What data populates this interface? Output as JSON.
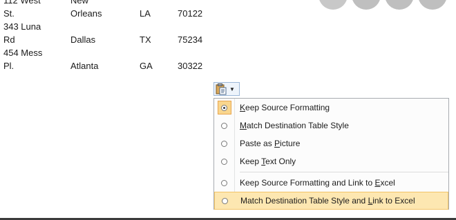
{
  "addresses": [
    {
      "street": "112 West",
      "city": "New",
      "state": "",
      "zip": ""
    },
    {
      "street": "St.",
      "city": "Orleans",
      "state": "LA",
      "zip": "70122"
    },
    {
      "street": "343 Luna",
      "city": "",
      "state": "",
      "zip": ""
    },
    {
      "street": "Rd",
      "city": "Dallas",
      "state": "TX",
      "zip": "75234"
    },
    {
      "street": "454 Mess",
      "city": "",
      "state": "",
      "zip": ""
    },
    {
      "street": "Pl.",
      "city": "Atlanta",
      "state": "GA",
      "zip": "30322"
    }
  ],
  "paste_options": {
    "button_icon": "clipboard-icon",
    "items": [
      {
        "prefix": "",
        "key": "K",
        "rest": "eep Source Formatting",
        "checked": true
      },
      {
        "prefix": "",
        "key": "M",
        "rest": "atch Destination Table Style",
        "checked": false
      },
      {
        "prefix": "Paste as ",
        "key": "P",
        "rest": "icture",
        "checked": false
      },
      {
        "prefix": "Keep ",
        "key": "T",
        "rest": "ext Only",
        "checked": false
      },
      {
        "prefix": "Keep Source Formatting and Link to ",
        "key": "E",
        "rest": "xcel",
        "checked": false
      },
      {
        "prefix": "Match Destination Table Style and ",
        "key": "L",
        "rest": "ink to Excel",
        "checked": false
      }
    ]
  },
  "colors": {
    "highlight": "#fde7b1",
    "checked_bg": "#f9d68e"
  }
}
